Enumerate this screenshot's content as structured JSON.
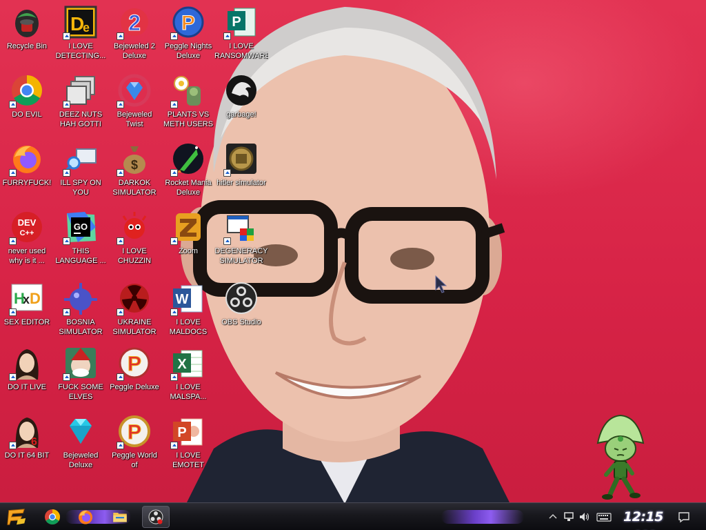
{
  "desktop": {
    "icons": [
      {
        "label": "Recycle Bin",
        "icon": "recycle-bin-icon"
      },
      {
        "label": "I LOVE\nDETECTING...",
        "icon": "de-app-icon"
      },
      {
        "label": "Bejeweled 2\nDeluxe",
        "icon": "bejeweled-2-icon"
      },
      {
        "label": "Peggle Nights\nDeluxe",
        "icon": "peggle-nights-icon"
      },
      {
        "label": "I LOVE\nRANSOMWARE",
        "icon": "publisher-icon"
      },
      {
        "label": "DO EVIL",
        "icon": "chrome-icon"
      },
      {
        "label": "DEEZ NUTS\nHAH GOTTI",
        "icon": "windows-stack-icon"
      },
      {
        "label": "Bejeweled\nTwist",
        "icon": "bejeweled-twist-icon"
      },
      {
        "label": "PLANTS VS\nMETH USERS",
        "icon": "plants-vs-zombies-icon"
      },
      {
        "label": "garbage!",
        "icon": "dragon-logo-icon"
      },
      {
        "label": "FURRYFUCK!",
        "icon": "firefox-icon"
      },
      {
        "label": "ILL SPY ON\nYOU",
        "icon": "network-spy-icon"
      },
      {
        "label": "DARKOK\nSIMULATOR",
        "icon": "money-bag-icon"
      },
      {
        "label": "Rocket Mania\nDeluxe",
        "icon": "rocket-mania-icon"
      },
      {
        "label": "hitler simulator",
        "icon": "coin-badge-icon"
      },
      {
        "label": "never used\nwhy is it ...",
        "icon": "dev-cpp-icon"
      },
      {
        "label": "THIS\nLANGUAGE ...",
        "icon": "goland-icon"
      },
      {
        "label": "I LOVE\nCHUZZIN",
        "icon": "chuzzle-icon"
      },
      {
        "label": "Zoom",
        "icon": "zuma-icon"
      },
      {
        "label": "DEGENERACY\nSIMULATOR",
        "icon": "degeneracy-app-icon"
      },
      {
        "label": "SEX EDITOR",
        "icon": "hxd-editor-icon"
      },
      {
        "label": "BOSNIA\nSIMULATOR",
        "icon": "mine-ball-icon"
      },
      {
        "label": "UKRAINE\nSIMULATOR",
        "icon": "radiation-icon"
      },
      {
        "label": "I LOVE\nMALDOCS",
        "icon": "word-icon"
      },
      {
        "label": "OBS Studio",
        "icon": "obs-icon"
      },
      {
        "label": "DO IT LIVE",
        "icon": "portrait-painting-icon"
      },
      {
        "label": "FUCK SOME\nELVES",
        "icon": "elf-game-icon"
      },
      {
        "label": "Peggle Deluxe",
        "icon": "peggle-icon"
      },
      {
        "label": "I LOVE\nMALSPA...",
        "icon": "excel-icon"
      },
      {
        "label": "DO IT 64 BIT",
        "icon": "portrait-64-icon"
      },
      {
        "label": "Bejeweled\nDeluxe",
        "icon": "diamond-icon"
      },
      {
        "label": "Peggle World of\nWarcraft Edition",
        "icon": "peggle-wow-icon"
      },
      {
        "label": "I LOVE EMOTET",
        "icon": "powerpoint-icon"
      }
    ]
  },
  "taskbar": {
    "pinned": [
      {
        "name": "start-button",
        "icon": "start-logo-icon"
      },
      {
        "name": "chrome-pinned",
        "icon": "chrome-icon"
      },
      {
        "name": "firefox-pinned",
        "icon": "firefox-icon"
      },
      {
        "name": "file-explorer-pinned",
        "icon": "folder-icon"
      },
      {
        "name": "obs-running",
        "icon": "obs-icon"
      }
    ],
    "tray": {
      "icons": [
        "chevron-up-icon",
        "network-icon",
        "volume-icon",
        "keyboard-icon",
        "notification-icon"
      ],
      "clock": "12:15 AM"
    }
  },
  "colors": {
    "wallpaper": "#d8284a",
    "taskbar": "#18181d",
    "taskbar_accent": "#7a4de0"
  }
}
